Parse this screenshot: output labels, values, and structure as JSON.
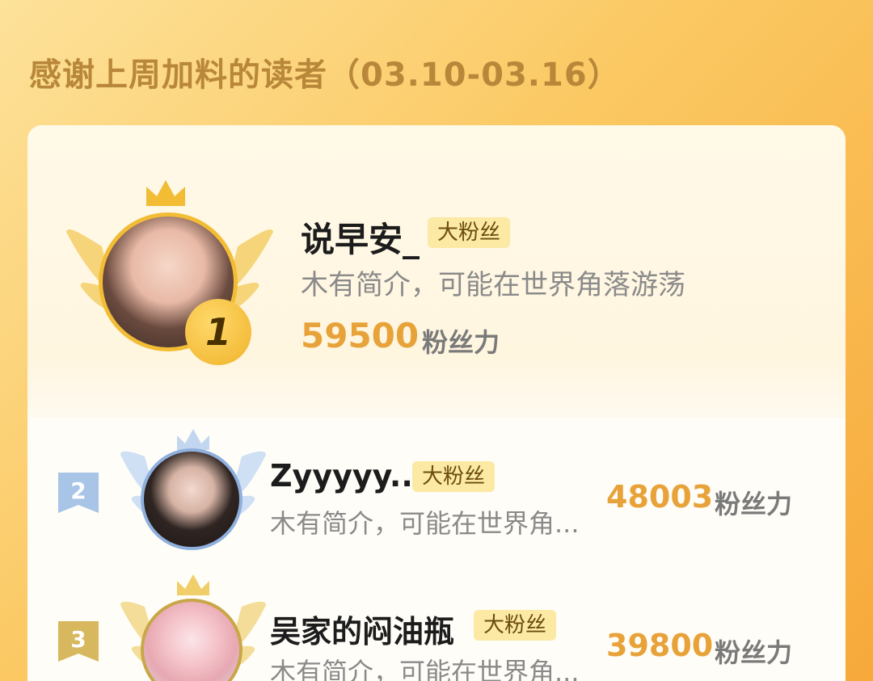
{
  "header": {
    "title": "感谢上周加料的读者（03.10-03.16）"
  },
  "readers": [
    {
      "rank": "1",
      "name": "说早安_",
      "tag": "大粉丝",
      "bio": "木有简介，可能在世界角落游荡",
      "score": "59500",
      "unit": "粉丝力"
    },
    {
      "rank": "2",
      "name": "Zyyyyy...",
      "tag": "大粉丝",
      "bio": "木有简介，可能在世界角...",
      "score": "48003",
      "unit": "粉丝力"
    },
    {
      "rank": "3",
      "name": "吴家的闷油瓶",
      "tag": "大粉丝",
      "bio": "木有简介，可能在世界角...",
      "score": "39800",
      "unit": "粉丝力"
    }
  ],
  "colors": {
    "gold": "#f2bd35",
    "silver": "#9fbbe0",
    "bronze": "#d8b35a",
    "score": "#e8a23a"
  }
}
